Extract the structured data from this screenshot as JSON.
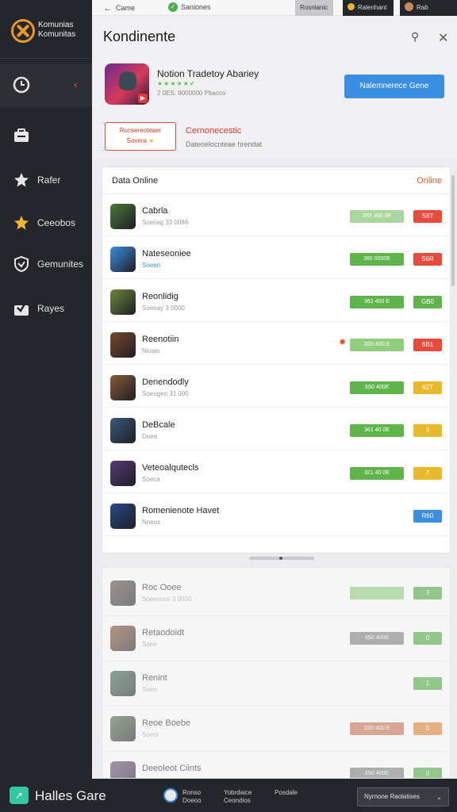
{
  "brand": {
    "line1": "Komunias",
    "line2": "Komunitas"
  },
  "sidebar": {
    "items": [
      {
        "label": "",
        "icon": "clock-icon",
        "active": true
      },
      {
        "label": "",
        "icon": "briefcase-icon",
        "active": false
      },
      {
        "label": "Rafer",
        "icon": "star-outline-icon",
        "active": false
      },
      {
        "label": "Ceeobos",
        "icon": "star-icon",
        "active": false
      },
      {
        "label": "Gemunites",
        "icon": "shield-icon",
        "active": false
      },
      {
        "label": "Rayes",
        "icon": "inbox-icon",
        "active": false
      }
    ]
  },
  "topbar": {
    "back_label": "Came",
    "status_label": "Saniones",
    "chip1": "Rosnlanic",
    "chip2": "Ralenhant",
    "chip3": "Rab"
  },
  "main": {
    "title": "Kondinente",
    "app": {
      "title": "Notion Tradetoy Abariey",
      "stars": "★★★★★✔",
      "meta": "2 0ES. 9000000 Pbacco",
      "primary_button": "Nalemnerece Gene"
    },
    "promo": {
      "box_line1": "Rucsereoteaer",
      "box_line2": "Sovera",
      "title": "Cernonecestic",
      "subtitle": "Dateoelocnteae hrendat"
    }
  },
  "card": {
    "title": "Data Online",
    "status": "Online",
    "rows": [
      {
        "name": "Cabrla",
        "sub": "Soeceg 33 0086",
        "pill_a": "3S1 400 0E",
        "pill_b": "S6T",
        "pill_a_color": "#a9d79d",
        "pill_b_color": "#e84a3c",
        "sub_blue": false,
        "flag": false
      },
      {
        "name": "Nateseoniee",
        "sub": "Soeen",
        "pill_a": "360 0000E",
        "pill_b": "S6R",
        "pill_a_color": "#5fb54a",
        "pill_b_color": "#e84a3c",
        "sub_blue": true,
        "flag": false
      },
      {
        "name": "Reonlidig",
        "sub": "Soenay 3 0000",
        "pill_a": "361 400 E",
        "pill_b": "GB0",
        "pill_a_color": "#5fb54a",
        "pill_b_color": "#5fb54a",
        "sub_blue": false,
        "flag": false
      },
      {
        "name": "Reenotiin",
        "sub": "Nioais",
        "pill_a": "3S0 400 E",
        "pill_b": "6B1",
        "pill_a_color": "#8fcf7e",
        "pill_b_color": "#e84a3c",
        "sub_blue": false,
        "flag": true
      },
      {
        "name": "Denendodly",
        "sub": "Soeogeo 31 000",
        "pill_a": "3S0 400E",
        "pill_b": "62T",
        "pill_a_color": "#5fb54a",
        "pill_b_color": "#e8b92a",
        "sub_blue": false,
        "flag": false
      },
      {
        "name": "DeBcale",
        "sub": "Doea",
        "pill_a": "361 40 0E",
        "pill_b": "3",
        "pill_a_color": "#5fb54a",
        "pill_b_color": "#e8b92a",
        "sub_blue": false,
        "flag": false
      },
      {
        "name": "Veteoalqutecls",
        "sub": "Soeca",
        "pill_a": "321 40 0E",
        "pill_b": "7",
        "pill_a_color": "#5fb54a",
        "pill_b_color": "#e8b92a",
        "sub_blue": false,
        "flag": false
      },
      {
        "name": "Romenienote Havet",
        "sub": "Noeos",
        "pill_a": "",
        "pill_b": "R60",
        "pill_a_color": "",
        "pill_b_color": "#3b8fe3",
        "sub_blue": false,
        "flag": false
      }
    ]
  },
  "card2": {
    "rows": [
      {
        "name": "Roc Ooee",
        "sub": "Soeeocos 3 0000",
        "pill_a": "",
        "pill_b": "3",
        "pill_a_color": "#8fcf7e",
        "pill_b_color": "#4aa83a"
      },
      {
        "name": "Retaodoidt",
        "sub": "Soeo",
        "pill_a": "3S0 400E",
        "pill_b": "0",
        "pill_a_color": "#7a7f7a",
        "pill_b_color": "#4aa83a"
      },
      {
        "name": "Renint",
        "sub": "Soeo",
        "pill_a": "",
        "pill_b": "1",
        "pill_a_color": "",
        "pill_b_color": "#4aa83a"
      },
      {
        "name": "Reoe Boebe",
        "sub": "Soeor",
        "pill_a": "3S0 400 E",
        "pill_b": "0",
        "pill_a_color": "#c9704a",
        "pill_b_color": "#e0802a"
      },
      {
        "name": "Deeoleot Ciints",
        "sub": "",
        "pill_a": "3S0 400E",
        "pill_b": "0",
        "pill_a_color": "#7a7f7a",
        "pill_b_color": "#4aa83a"
      }
    ]
  },
  "bottombar": {
    "title": "Halles Gare",
    "col1_l1": "Ronso",
    "col1_l2": "Doeoo",
    "col2_l1": "Yobrdaice",
    "col2_l2": "Ceondios",
    "col3_l1": "Posdale",
    "col3_l2": "",
    "select_value": "Nyrnone Raolatises"
  }
}
